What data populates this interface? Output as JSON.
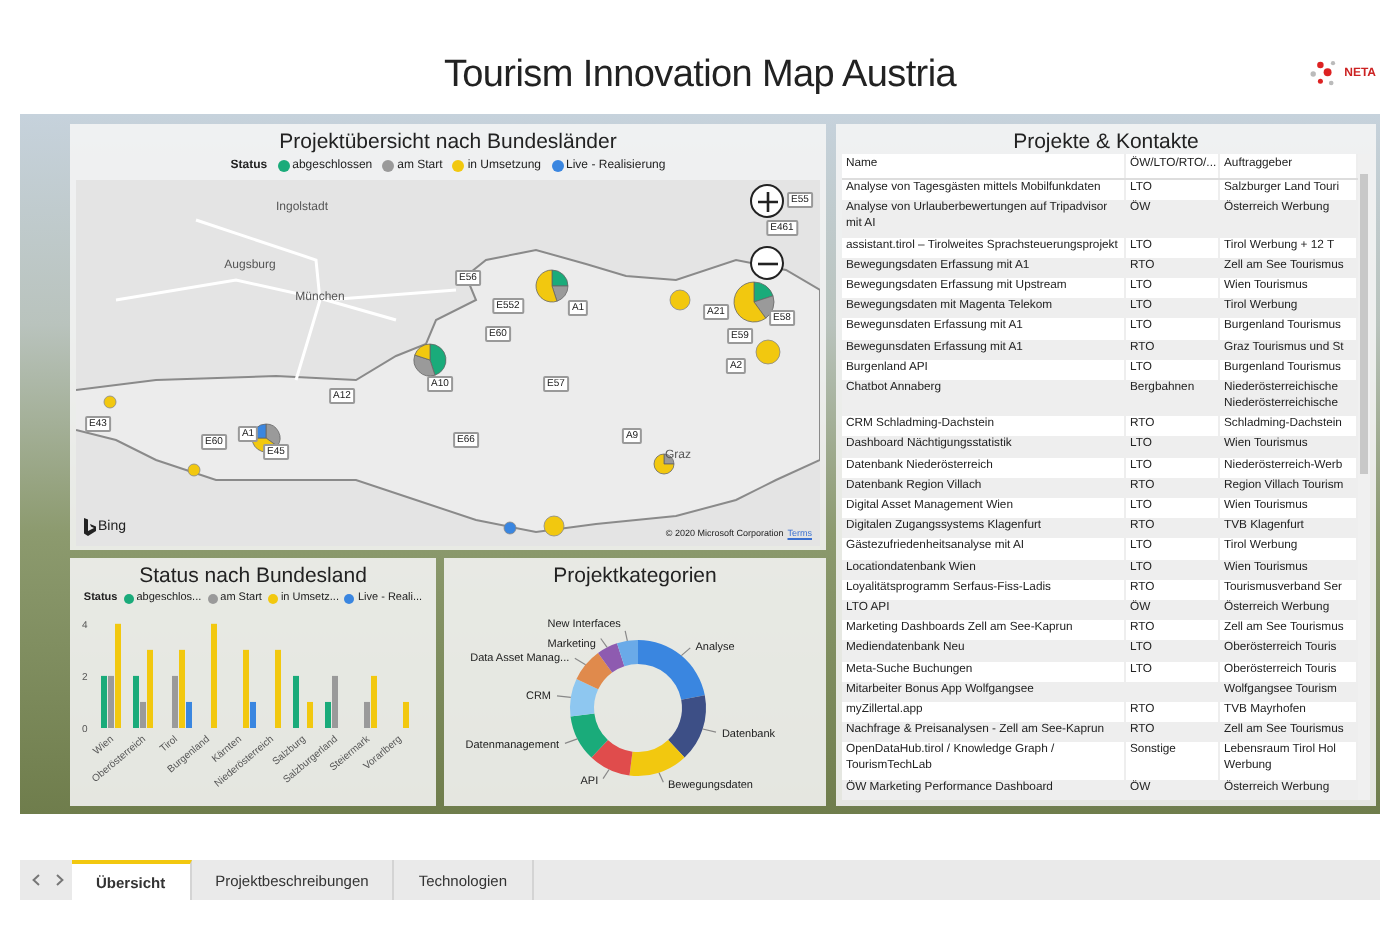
{
  "header": {
    "title": "Tourism Innovation Map Austria",
    "logo_text": "NETA"
  },
  "map_panel": {
    "title": "Projektübersicht nach Bundesländer",
    "legend_label": "Status",
    "legend": [
      {
        "label": "abgeschlossen",
        "color": "#1aab7a"
      },
      {
        "label": "am Start",
        "color": "#9a9a9a"
      },
      {
        "label": "in Umsetzung",
        "color": "#f2c80f"
      },
      {
        "label": "Live - Realisierung",
        "color": "#3a86e0"
      }
    ],
    "labels": [
      {
        "text": "Ingolstadt",
        "kind": "city"
      },
      {
        "text": "Augsburg",
        "kind": "city"
      },
      {
        "text": "München",
        "kind": "city"
      },
      {
        "text": "E56",
        "kind": "road"
      },
      {
        "text": "E552",
        "kind": "road"
      },
      {
        "text": "E60",
        "kind": "road"
      },
      {
        "text": "A1",
        "kind": "road"
      },
      {
        "text": "E461",
        "kind": "road"
      },
      {
        "text": "E55",
        "kind": "road"
      },
      {
        "text": "A21",
        "kind": "road"
      },
      {
        "text": "E59",
        "kind": "road"
      },
      {
        "text": "E58",
        "kind": "road"
      },
      {
        "text": "A2",
        "kind": "road"
      },
      {
        "text": "A12",
        "kind": "road"
      },
      {
        "text": "A10",
        "kind": "road"
      },
      {
        "text": "E57",
        "kind": "road"
      },
      {
        "text": "E43",
        "kind": "road"
      },
      {
        "text": "A1",
        "kind": "road"
      },
      {
        "text": "E60",
        "kind": "road"
      },
      {
        "text": "E45",
        "kind": "road"
      },
      {
        "text": "E66",
        "kind": "road"
      },
      {
        "text": "A9",
        "kind": "road"
      },
      {
        "text": "Graz",
        "kind": "city"
      }
    ],
    "brand": "Bing",
    "copyright": "© 2020 Microsoft Corporation",
    "terms": "Terms"
  },
  "status_chart": {
    "title": "Status nach Bundesland",
    "legend_label": "Status",
    "chart_data": {
      "type": "bar",
      "categories": [
        "Wien",
        "Oberösterreich",
        "Tirol",
        "Burgenland",
        "Kärnten",
        "Niederösterreich",
        "Salzburg",
        "Salzburgerland",
        "Steiermark",
        "Vorarlberg"
      ],
      "yticks": [
        0,
        2,
        4
      ],
      "ylim": [
        0,
        4.3
      ],
      "series": [
        {
          "name": "abgeschlos...",
          "color": "#1aab7a",
          "values": [
            2,
            2,
            null,
            null,
            null,
            null,
            2,
            1,
            null,
            null
          ]
        },
        {
          "name": "am Start",
          "color": "#9a9a9a",
          "values": [
            2,
            1,
            2,
            null,
            null,
            null,
            null,
            2,
            1,
            null
          ]
        },
        {
          "name": "in Umsetz...",
          "color": "#f2c80f",
          "values": [
            4,
            3,
            3,
            4,
            3,
            3,
            1,
            null,
            2,
            1
          ]
        },
        {
          "name": "Live - Reali...",
          "color": "#3a86e0",
          "values": [
            null,
            null,
            1,
            null,
            1,
            null,
            null,
            null,
            null,
            null
          ]
        }
      ]
    }
  },
  "category_chart": {
    "title": "Projektkategorien",
    "chart_data": {
      "type": "donut",
      "categories": [
        "Analyse",
        "Datenbank",
        "Bewegungsdaten",
        "API",
        "Datenmanagement",
        "CRM",
        "Data Asset Manag...",
        "Marketing",
        "New Interfaces"
      ],
      "series": [
        {
          "values": [
            22,
            16,
            14,
            10,
            11,
            9,
            8,
            5,
            5
          ]
        }
      ],
      "colors": [
        "#3a86e0",
        "#3d4f86",
        "#f2c80f",
        "#e04c4c",
        "#1aab7a",
        "#8ec7f0",
        "#e08a4c",
        "#8e5bb0",
        "#6aaae8"
      ]
    }
  },
  "table": {
    "title": "Projekte & Kontakte",
    "columns": [
      "Name",
      "ÖW/LTO/RTO/...",
      "Auftraggeber"
    ],
    "rows": [
      [
        "Analyse von Tagesgästen mittels Mobilfunkdaten",
        "LTO",
        "Salzburger Land Touri"
      ],
      [
        "Analyse von Urlauberbewertungen auf Tripadvisor mit AI",
        "ÖW",
        "Österreich Werbung"
      ],
      [
        "assistant.tirol – Tirolweites Sprachsteuerungsprojekt",
        "LTO",
        "Tirol Werbung + 12 T"
      ],
      [
        "Bewegungsdaten Erfassung mit A1",
        "RTO",
        "Zell am See Tourismus"
      ],
      [
        "Bewegungsdaten Erfassung mit Upstream",
        "LTO",
        "Wien Tourismus"
      ],
      [
        "Bewegungsdaten mit Magenta Telekom",
        "LTO",
        "Tirol Werbung"
      ],
      [
        "Bewegunsdaten Erfassung mit A1",
        "LTO",
        "Burgenland Tourismus"
      ],
      [
        "Bewegunsdaten Erfassung mit A1",
        "RTO",
        "Graz Tourismus und St"
      ],
      [
        "Burgenland API",
        "LTO",
        "Burgenland Tourismus"
      ],
      [
        "Chatbot Annaberg",
        "Bergbahnen",
        "Niederösterreichische\nNiederösterreichische"
      ],
      [
        "CRM Schladming-Dachstein",
        "RTO",
        "Schladming-Dachstein"
      ],
      [
        "Dashboard Nächtigungsstatistik",
        "LTO",
        "Wien Tourismus"
      ],
      [
        "Datenbank Niederösterreich",
        "LTO",
        "Niederösterreich-Werb"
      ],
      [
        "Datenbank Region Villach",
        "RTO",
        "Region Villach Tourism"
      ],
      [
        "Digital Asset Management Wien",
        "LTO",
        "Wien Tourismus"
      ],
      [
        "Digitalen Zugangssystems Klagenfurt",
        "RTO",
        "TVB Klagenfurt"
      ],
      [
        "Gästezufriedenheitsanalyse mit AI",
        "LTO",
        "Tirol Werbung"
      ],
      [
        "Locationdatenbank Wien",
        "LTO",
        "Wien Tourismus"
      ],
      [
        "Loyalitätsprogramm Serfaus-Fiss-Ladis",
        "RTO",
        "Tourismusverband Ser"
      ],
      [
        "LTO API",
        "ÖW",
        "Österreich Werbung"
      ],
      [
        "Marketing Dashboards Zell am See-Kaprun",
        "RTO",
        "Zell am See Tourismus"
      ],
      [
        "Mediendatenbank Neu",
        "LTO",
        "Oberösterreich Touris"
      ],
      [
        "Meta-Suche Buchungen",
        "LTO",
        "Oberösterreich Touris"
      ],
      [
        "Mitarbeiter Bonus App Wolfgangsee",
        "",
        "Wolfgangsee Tourism"
      ],
      [
        "myZillertal.app",
        "RTO",
        "TVB Mayrhofen"
      ],
      [
        "Nachfrage & Preisanalysen - Zell am See-Kaprun",
        "RTO",
        "Zell am See Tourismus"
      ],
      [
        "OpenDataHub.tirol / Knowledge Graph / TourismTechLab",
        "Sonstige",
        "Lebensraum Tirol Hol\nWerbung"
      ],
      [
        "ÖW Marketing Performance Dashboard",
        "ÖW",
        "Österreich Werbung"
      ]
    ]
  },
  "tabs": [
    {
      "label": "Übersicht",
      "selected": true
    },
    {
      "label": "Projektbeschreibungen",
      "selected": false
    },
    {
      "label": "Technologien",
      "selected": false
    }
  ]
}
